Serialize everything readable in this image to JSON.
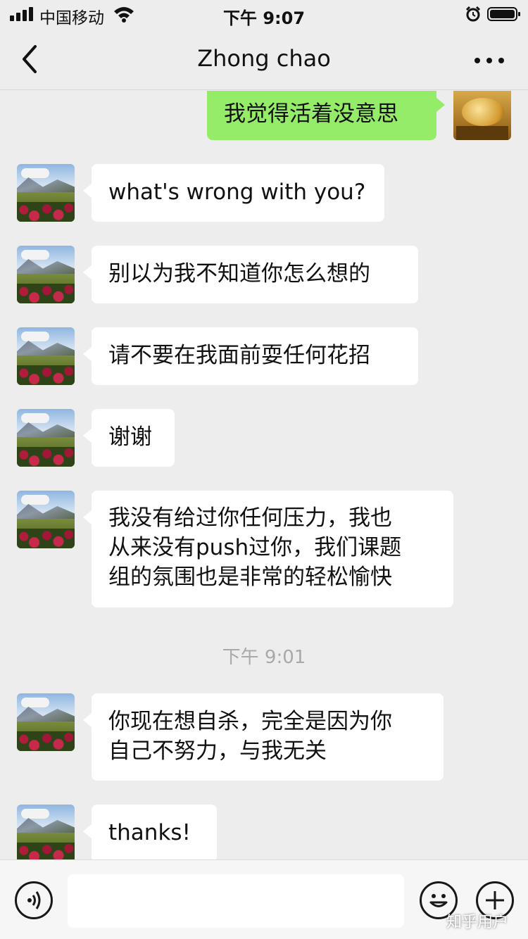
{
  "status_bar": {
    "carrier": "中国移动",
    "time": "下午 9:07"
  },
  "nav": {
    "title": "Zhong chao",
    "back_icon": "chevron-left-icon",
    "more_icon": "more-dots-icon"
  },
  "messages": [
    {
      "side": "right",
      "text": "我觉得活着没意思"
    },
    {
      "side": "left",
      "text": "what's wrong with you?"
    },
    {
      "side": "left",
      "text": "别以为我不知道你怎么想的"
    },
    {
      "side": "left",
      "text": "请不要在我面前耍任何花招"
    },
    {
      "side": "left",
      "text": "谢谢"
    },
    {
      "side": "left",
      "lines": [
        "我没有给过你任何压力，我也",
        "从来没有push过你，我们课题",
        "组的氛围也是非常的轻松愉快"
      ]
    },
    {
      "side": "left",
      "lines": [
        "你现在想自杀，完全是因为你",
        "自己不努力，与我无关"
      ]
    },
    {
      "side": "left",
      "text": "thanks!"
    }
  ],
  "time_divider": "下午 9:01",
  "input_bar": {
    "voice_icon": "voice-icon",
    "emoji_icon": "emoji-icon",
    "plus_icon": "plus-icon",
    "text_value": ""
  },
  "watermark": "知乎用户",
  "colors": {
    "background": "#ededed",
    "self_bubble": "#95ec69",
    "other_bubble": "#ffffff"
  }
}
